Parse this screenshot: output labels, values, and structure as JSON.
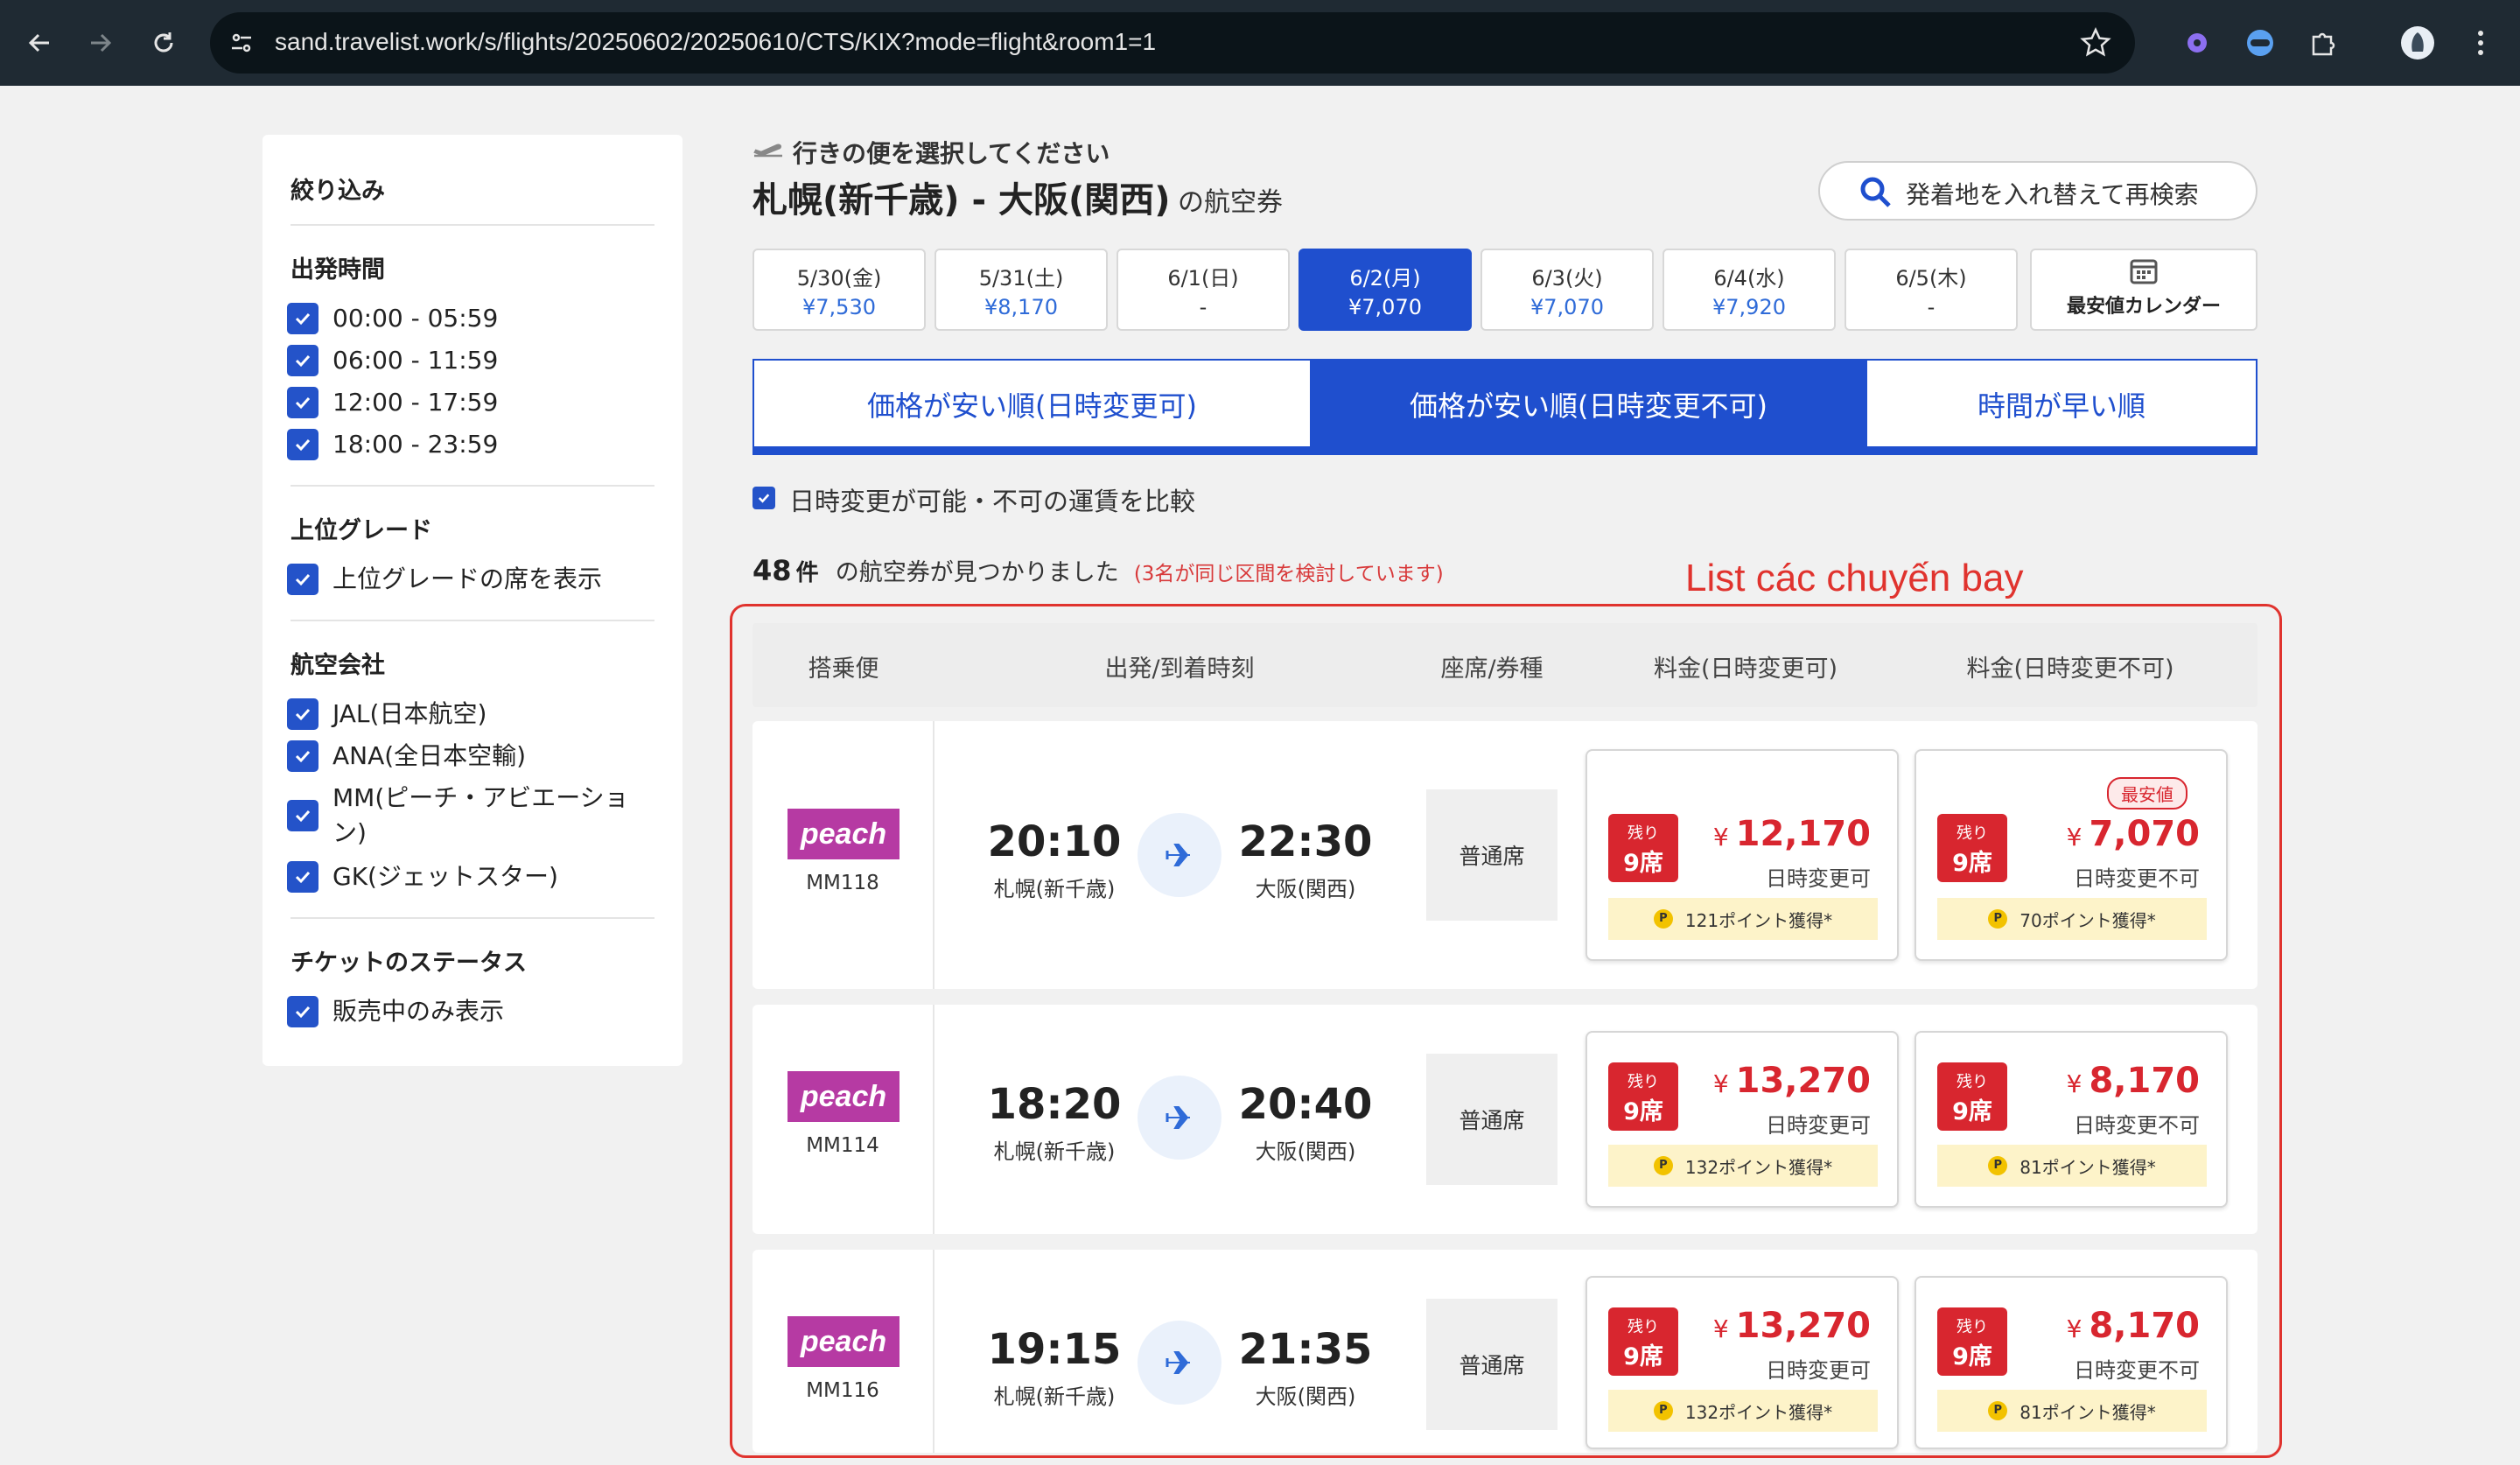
{
  "browser": {
    "url": "sand.travelist.work/s/flights/20250602/20250610/CTS/KIX?mode=flight&room1=1"
  },
  "sidebar": {
    "title": "絞り込み",
    "sections": [
      {
        "title": "出発時間",
        "items": [
          "00:00 - 05:59",
          "06:00 - 11:59",
          "12:00 - 17:59",
          "18:00 - 23:59"
        ]
      },
      {
        "title": "上位グレード",
        "items": [
          "上位グレードの席を表示"
        ]
      },
      {
        "title": "航空会社",
        "items": [
          "JAL(日本航空)",
          "ANA(全日本空輸)",
          "MM(ピーチ・アビエーション)",
          "GK(ジェットスター)"
        ]
      },
      {
        "title": "チケットのステータス",
        "items": [
          "販売中のみ表示"
        ]
      }
    ]
  },
  "header": {
    "subtitle": "行きの便を選択してください",
    "route": "札幌(新千歳) - 大阪(関西)",
    "route_suffix": "の航空券",
    "swap_button": "発着地を入れ替えて再検索"
  },
  "dates": [
    {
      "date": "5/30(金)",
      "price": "¥7,530"
    },
    {
      "date": "5/31(土)",
      "price": "¥8,170"
    },
    {
      "date": "6/1(日)",
      "price": "-"
    },
    {
      "date": "6/2(月)",
      "price": "¥7,070",
      "selected": true
    },
    {
      "date": "6/3(火)",
      "price": "¥7,070"
    },
    {
      "date": "6/4(水)",
      "price": "¥7,920"
    },
    {
      "date": "6/5(木)",
      "price": "-"
    }
  ],
  "calendar_label": "最安値カレンダー",
  "sort_tabs": [
    {
      "label": "価格が安い順(日時変更可)",
      "active": false
    },
    {
      "label": "価格が安い順(日時変更不可)",
      "active": true
    },
    {
      "label": "時間が早い順",
      "active": false
    }
  ],
  "compare_label": "日時変更が可能・不可の運賃を比較",
  "results": {
    "count": "48",
    "unit": "件",
    "text": "の航空券が見つかりました",
    "notice": "(3名が同じ区間を検討しています)"
  },
  "annotation": "List các chuyến bay",
  "table": {
    "headers": [
      "搭乗便",
      "出発/到着時刻",
      "座席/券種",
      "料金(日時変更可)",
      "料金(日時変更不可)"
    ]
  },
  "flights": [
    {
      "airline_logo": "peach",
      "number": "MM118",
      "dep_time": "20:10",
      "dep_airport": "札幌(新千歳)",
      "arr_time": "22:30",
      "arr_airport": "大阪(関西)",
      "seat": "普通席",
      "fares": [
        {
          "rem_top": "残り",
          "rem_seats": "9席",
          "yen": "¥",
          "price": "12,170",
          "type": "日時変更可",
          "points": "121ポイント獲得*",
          "badge": ""
        },
        {
          "rem_top": "残り",
          "rem_seats": "9席",
          "yen": "¥",
          "price": "7,070",
          "type": "日時変更不可",
          "points": "70ポイント獲得*",
          "badge": "最安値"
        }
      ]
    },
    {
      "airline_logo": "peach",
      "number": "MM114",
      "dep_time": "18:20",
      "dep_airport": "札幌(新千歳)",
      "arr_time": "20:40",
      "arr_airport": "大阪(関西)",
      "seat": "普通席",
      "fares": [
        {
          "rem_top": "残り",
          "rem_seats": "9席",
          "yen": "¥",
          "price": "13,270",
          "type": "日時変更可",
          "points": "132ポイント獲得*",
          "badge": ""
        },
        {
          "rem_top": "残り",
          "rem_seats": "9席",
          "yen": "¥",
          "price": "8,170",
          "type": "日時変更不可",
          "points": "81ポイント獲得*",
          "badge": ""
        }
      ]
    },
    {
      "airline_logo": "peach",
      "number": "MM116",
      "dep_time": "19:15",
      "dep_airport": "札幌(新千歳)",
      "arr_time": "21:35",
      "arr_airport": "大阪(関西)",
      "seat": "普通席",
      "fares": [
        {
          "rem_top": "残り",
          "rem_seats": "9席",
          "yen": "¥",
          "price": "13,270",
          "type": "日時変更可",
          "points": "132ポイント獲得*",
          "badge": ""
        },
        {
          "rem_top": "残り",
          "rem_seats": "9席",
          "yen": "¥",
          "price": "8,170",
          "type": "日時変更不可",
          "points": "81ポイント獲得*",
          "badge": ""
        }
      ]
    }
  ],
  "point_coin": "P",
  "colors": {
    "accent": "#1f4fce",
    "price_red": "#d8262f",
    "peach": "#b63aa3",
    "annotation": "#e0332e"
  }
}
